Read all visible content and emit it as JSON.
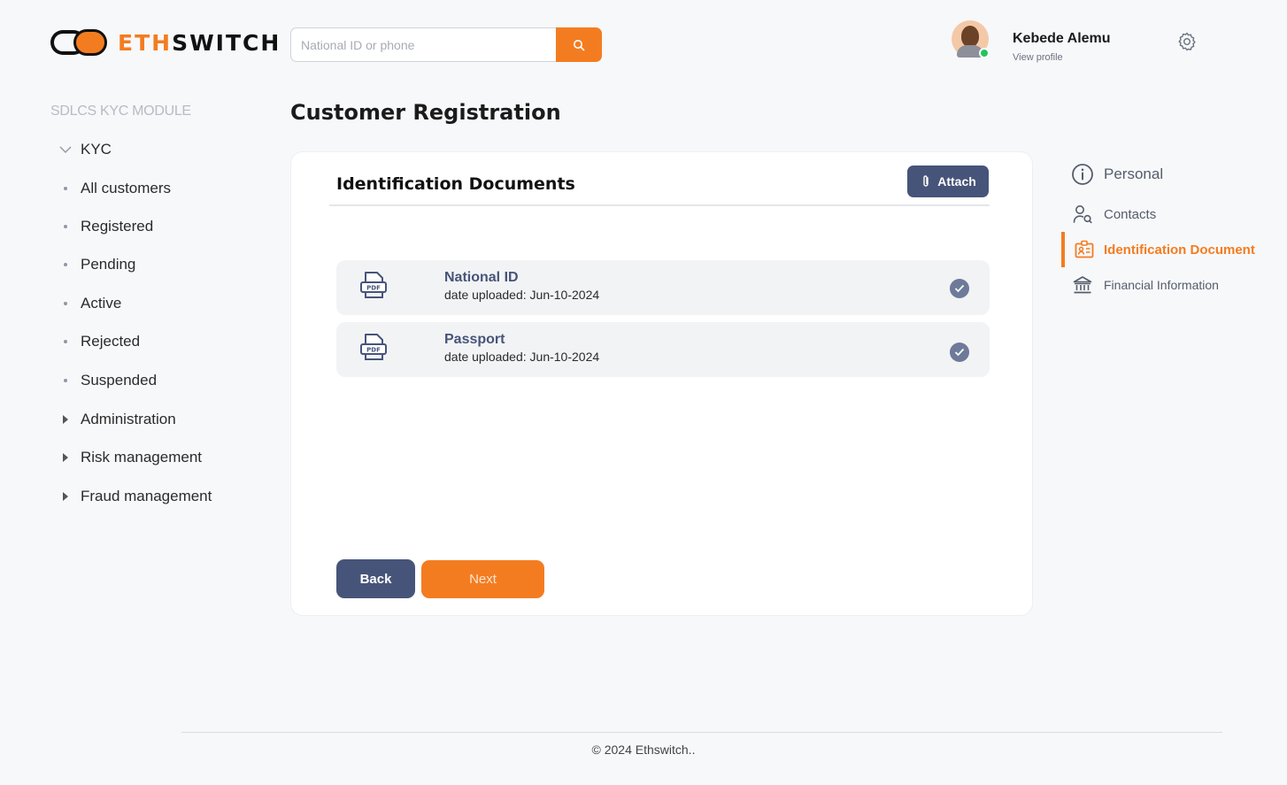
{
  "brand": {
    "part1": "ETH",
    "part2": "SWITCH",
    "accent_color": "#f47c20",
    "primary_color": "#475479"
  },
  "search": {
    "placeholder": "National ID or phone",
    "value": "",
    "button_icon": "search-icon"
  },
  "user": {
    "name": "Kebede Alemu",
    "link": "View profile",
    "status": "online"
  },
  "settings_icon": "gear-icon",
  "sidebar": {
    "module_title": "SDLCS KYC MODULE",
    "items": [
      {
        "label": "KYC",
        "marker": "chevron-down"
      },
      {
        "label": "All customers",
        "marker": "bullet"
      },
      {
        "label": "Registered",
        "marker": "bullet"
      },
      {
        "label": "Pending",
        "marker": "bullet"
      },
      {
        "label": "Active",
        "marker": "bullet"
      },
      {
        "label": "Rejected",
        "marker": "bullet"
      },
      {
        "label": "Suspended",
        "marker": "bullet"
      },
      {
        "label": "Administration",
        "marker": "caret-right"
      },
      {
        "label": "Risk management",
        "marker": "caret-right"
      },
      {
        "label": "Fraud management",
        "marker": "caret-right"
      }
    ]
  },
  "page": {
    "title": "Customer Registration",
    "section_title": "Identification Documents",
    "attach_label": "Attach",
    "documents": [
      {
        "name": "National ID",
        "date": "date uploaded: Jun-10-2024",
        "icon": "pdf-file-icon",
        "verified": true
      },
      {
        "name": "Passport",
        "date": "date uploaded: Jun-10-2024",
        "icon": "pdf-file-icon",
        "verified": true
      }
    ],
    "back_label": "Back",
    "next_label": "Next"
  },
  "steps": [
    {
      "label": "Personal",
      "icon": "info-icon",
      "active": false
    },
    {
      "label": "Contacts",
      "icon": "user-contact-icon",
      "active": false
    },
    {
      "label": "Identification Document",
      "icon": "id-card-icon",
      "active": true
    },
    {
      "label": "Financial Information",
      "icon": "bank-icon",
      "active": false
    }
  ],
  "footer": {
    "text": "© 2024  Ethswitch.."
  }
}
